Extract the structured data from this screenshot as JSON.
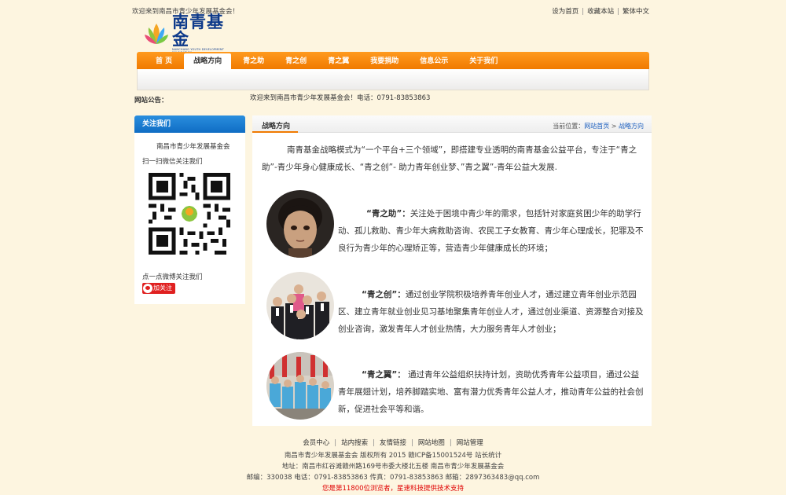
{
  "topbar": {
    "welcome": "欢迎来到南昌市青少年发展基金会！",
    "links": [
      "设为首页",
      "收藏本站",
      "繁体中文"
    ]
  },
  "logo": {
    "name_cn": "南青基金",
    "name_en": "NANCHANG YOUTH DEVELOPMENT FOUNDATION"
  },
  "nav": {
    "items": [
      "首 页",
      "战略方向",
      "青之助",
      "青之创",
      "青之翼",
      "我要捐助",
      "信息公示",
      "关于我们"
    ],
    "active_index": 1
  },
  "notice": {
    "label": "网站公告：",
    "text": "欢迎来到南昌市青少年发展基金会！电话：0791-83853863"
  },
  "sidebar": {
    "title": "关注我们",
    "org": "南昌市青少年发展基金会",
    "scan": "扫一扫微信关注我们",
    "weibo": "点一点微博关注我们",
    "follow_label": "加关注"
  },
  "main": {
    "title": "战略方向",
    "breadcrumb": {
      "prefix": "当前位置：",
      "home": "网站首页",
      "sep": " > ",
      "current": "战略方向"
    },
    "intro": "南青基金战略模式为“一个平台+三个领域”，即搭建专业透明的南青基金公益平台，专注于“青之助”-青少年身心健康成长、“青之创”- 助力青年创业梦、”青之翼”-青年公益大发展.",
    "sections": [
      {
        "title": "“青之助”：",
        "text": "关注处于困境中青少年的需求，包括针对家庭贫困少年的助学行动、孤儿救助、青少年大病救助咨询、农民工子女教育、青少年心理成长，犯罪及不良行为青少年的心理矫正等，营造青少年健康成长的环境；"
      },
      {
        "title": "“青之创”：",
        "text": "通过创业学院积极培养青年创业人才，通过建立青年创业示范园区、建立青年就业创业见习基地聚集青年创业人才，通过创业渠道、资源整合对接及创业咨询，激发青年人才创业热情，大力服务青年人才创业；"
      },
      {
        "title": "“青之翼”：",
        "text": " 通过青年公益组织扶持计划，资助优秀青年公益项目，通过公益青年展翅计划，培养脚踏实地、富有潜力优秀青年公益人才，推动青年公益的社会创新，促进社会平等和谐。"
      }
    ]
  },
  "footer": {
    "links": [
      "会员中心",
      "站内搜索",
      "友情链接",
      "网站地图",
      "网站管理"
    ],
    "copyright": "南昌市青少年发展基金会 版权所有 2015 赣ICP备15001524号 站长统计",
    "address": "地址：南昌市红谷滩赣州路169号市委大楼北五楼 南昌市青少年发展基金会",
    "contact": "邮编：330038 电话：0791-83853863 传真：0791-83853863 邮箱：2897363483@qq.com",
    "visits": "您是第11800位浏览者，星速科技提供技术支持"
  },
  "colors": {
    "nav_orange": "#f07a00",
    "sidebar_blue": "#0f6dc4",
    "link_blue": "#1c5fbf",
    "page_bg": "#fdf5e0"
  }
}
